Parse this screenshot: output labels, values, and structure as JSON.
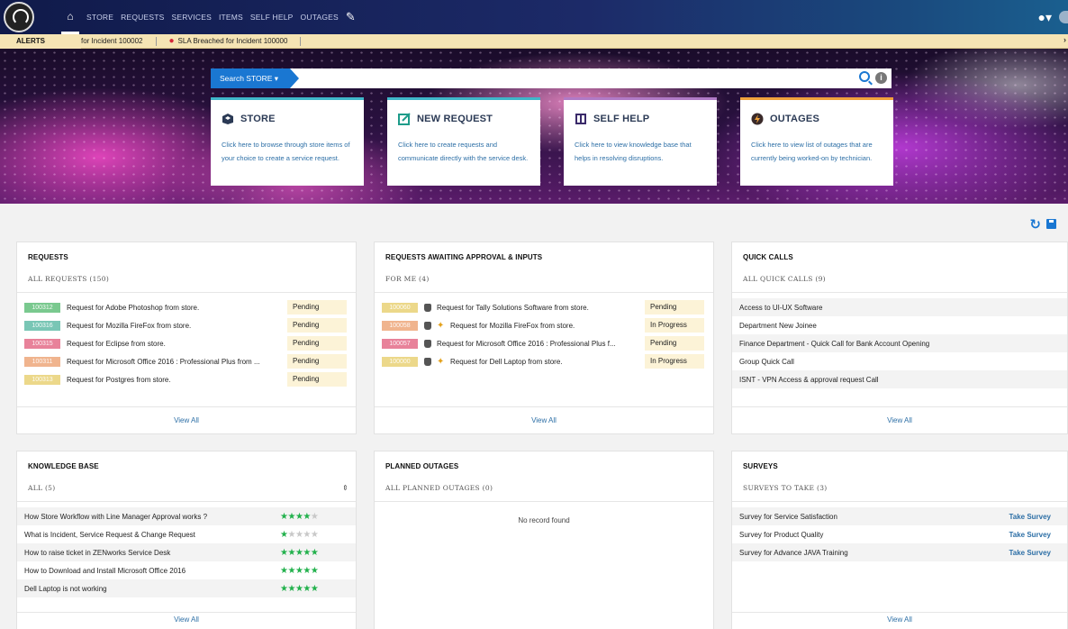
{
  "nav": {
    "items": [
      "STORE",
      "REQUESTS",
      "SERVICES",
      "ITEMS",
      "SELF HELP",
      "OUTAGES"
    ]
  },
  "alerts": {
    "label": "ALERTS",
    "items": [
      "for Incident 100002",
      "SLA Breached for Incident 100000"
    ]
  },
  "search": {
    "button_label": "Search STORE",
    "placeholder": ""
  },
  "hero_cards": [
    {
      "title": "STORE",
      "desc": "Click here to browse through store items of your choice to create a service request.",
      "icon": "store-icon"
    },
    {
      "title": "NEW REQUEST",
      "desc": "Click here to create requests and communicate directly with the service desk.",
      "icon": "new-request-icon"
    },
    {
      "title": "SELF HELP",
      "desc": "Click here to view knowledge base that helps in resolving disruptions.",
      "icon": "self-help-icon"
    },
    {
      "title": "OUTAGES",
      "desc": "Click here to view list of outages that are currently being worked-on by technician.",
      "icon": "outages-icon"
    }
  ],
  "requests": {
    "title": "REQUESTS",
    "subtitle": "ALL REQUESTS (150)",
    "rows": [
      {
        "id": "100312",
        "color": "#7ac98f",
        "text": "Request for Adobe Photoshop from store.",
        "status": "Pending"
      },
      {
        "id": "100316",
        "color": "#79c6b5",
        "text": "Request for Mozilla FireFox from store.",
        "status": "Pending"
      },
      {
        "id": "100315",
        "color": "#e8829a",
        "text": "Request for Eclipse from store.",
        "status": "Pending"
      },
      {
        "id": "100311",
        "color": "#f0b48e",
        "text": "Request for Microsoft Office 2016 : Professional Plus from ...",
        "status": "Pending"
      },
      {
        "id": "100313",
        "color": "#ecd88a",
        "text": "Request for Postgres from store.",
        "status": "Pending"
      }
    ],
    "view_all": "View All"
  },
  "approvals": {
    "title": "REQUESTS AWAITING APPROVAL & INPUTS",
    "subtitle": "FOR ME (4)",
    "rows": [
      {
        "id": "100060",
        "color": "#ecd88a",
        "key": false,
        "text": "Request for Tally Solutions Software from store.",
        "status": "Pending"
      },
      {
        "id": "100058",
        "color": "#f0b48e",
        "key": true,
        "text": "Request for Mozilla FireFox from store.",
        "status": "In Progress"
      },
      {
        "id": "100057",
        "color": "#e8829a",
        "key": false,
        "text": "Request for Microsoft Office 2016 : Professional Plus f...",
        "status": "Pending"
      },
      {
        "id": "100000",
        "color": "#ecd88a",
        "key": true,
        "text": "Request for Dell Laptop from store.",
        "status": "In Progress"
      }
    ],
    "view_all": "View All"
  },
  "quick_calls": {
    "title": "QUICK CALLS",
    "subtitle": "ALL QUICK CALLS (9)",
    "rows": [
      "Access to UI-UX Software",
      "Department New Joinee",
      "Finance Department - Quick Call for Bank Account Opening",
      "Group Quick Call",
      "ISNT - VPN Access & approval request Call"
    ],
    "view_all": "View All"
  },
  "knowledge_base": {
    "title": "KNOWLEDGE BASE",
    "subtitle": "ALL (5)",
    "sort_icon": "sort-icon",
    "rows": [
      {
        "text": "How Store Workflow with Line Manager Approval works ?",
        "rating": 4
      },
      {
        "text": "What is Incident, Service Request & Change Request",
        "rating": 1
      },
      {
        "text": "How to raise ticket in ZENworks Service Desk",
        "rating": 5
      },
      {
        "text": "How to Download and Install Microsoft Office 2016",
        "rating": 5
      },
      {
        "text": "Dell Laptop is not working",
        "rating": 5
      }
    ],
    "view_all": "View All"
  },
  "planned_outages": {
    "title": "PLANNED OUTAGES",
    "subtitle": "ALL PLANNED OUTAGES (0)",
    "empty_text": "No record found"
  },
  "surveys": {
    "title": "SURVEYS",
    "subtitle": "SURVEYS TO TAKE (3)",
    "rows": [
      {
        "text": "Survey for Service Satisfaction",
        "action": "Take Survey"
      },
      {
        "text": "Survey for Product Quality",
        "action": "Take Survey"
      },
      {
        "text": "Survey for Advance JAVA Training",
        "action": "Take Survey"
      }
    ],
    "view_all": "View All"
  },
  "colors": {
    "accent": "#1a77d2",
    "link": "#2d6fa6",
    "status_bg": "#fcf3d7",
    "star": "#22b14c"
  }
}
